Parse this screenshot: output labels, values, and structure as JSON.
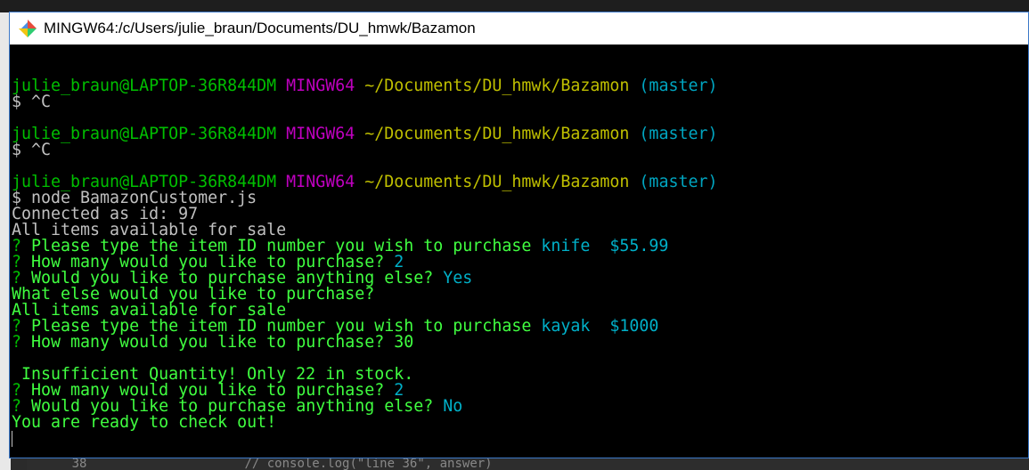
{
  "window": {
    "title": "MINGW64:/c/Users/julie_braun/Documents/DU_hmwk/Bazamon"
  },
  "background_editor": {
    "bottom_line_number": "38",
    "bottom_code": "// console.log(\"line 36\", answer)"
  },
  "colors": {
    "prompt_user": "#00bf00",
    "prompt_mingw": "#bf00bf",
    "prompt_path": "#bfbf00",
    "prompt_branch": "#00a5c0",
    "plain": "#c0c0c0",
    "question_mark": "#00c000",
    "question_text": "#40ff40",
    "answer": "#00b0c8"
  },
  "terminal": {
    "lines": [
      [],
      [
        {
          "t": "julie_braun@LAPTOP-36R844DM",
          "c": "prompt_user"
        },
        {
          "t": " MINGW64",
          "c": "prompt_mingw"
        },
        {
          "t": " ~/Documents/DU_hmwk/Bazamon",
          "c": "prompt_path"
        },
        {
          "t": " (master)",
          "c": "prompt_branch"
        }
      ],
      [
        {
          "t": "$ ^C",
          "c": "plain"
        }
      ],
      [],
      [
        {
          "t": "julie_braun@LAPTOP-36R844DM",
          "c": "prompt_user"
        },
        {
          "t": " MINGW64",
          "c": "prompt_mingw"
        },
        {
          "t": " ~/Documents/DU_hmwk/Bazamon",
          "c": "prompt_path"
        },
        {
          "t": " (master)",
          "c": "prompt_branch"
        }
      ],
      [
        {
          "t": "$ ^C",
          "c": "plain"
        }
      ],
      [],
      [
        {
          "t": "julie_braun@LAPTOP-36R844DM",
          "c": "prompt_user"
        },
        {
          "t": " MINGW64",
          "c": "prompt_mingw"
        },
        {
          "t": " ~/Documents/DU_hmwk/Bazamon",
          "c": "prompt_path"
        },
        {
          "t": " (master)",
          "c": "prompt_branch"
        }
      ],
      [
        {
          "t": "$ node BamazonCustomer.js",
          "c": "plain"
        }
      ],
      [
        {
          "t": "Connected as id: 97",
          "c": "plain"
        }
      ],
      [
        {
          "t": "All items available for sale",
          "c": "plain"
        }
      ],
      [
        {
          "t": "?",
          "c": "question_mark"
        },
        {
          "t": " Please type the item ID number you wish to purchase ",
          "c": "question_text"
        },
        {
          "t": "knife  $55.99",
          "c": "answer"
        }
      ],
      [
        {
          "t": "?",
          "c": "question_mark"
        },
        {
          "t": " How many would you like to purchase? ",
          "c": "question_text"
        },
        {
          "t": "2",
          "c": "answer"
        }
      ],
      [
        {
          "t": "?",
          "c": "question_mark"
        },
        {
          "t": " Would you like to purchase anything else? ",
          "c": "question_text"
        },
        {
          "t": "Yes",
          "c": "answer"
        }
      ],
      [
        {
          "t": "What else would you like to purchase?",
          "c": "question_text"
        }
      ],
      [
        {
          "t": "All items available for sale",
          "c": "question_text"
        }
      ],
      [
        {
          "t": "?",
          "c": "question_mark"
        },
        {
          "t": " Please type the item ID number you wish to purchase ",
          "c": "question_text"
        },
        {
          "t": "kayak  $1000",
          "c": "answer"
        }
      ],
      [
        {
          "t": "?",
          "c": "question_mark"
        },
        {
          "t": " How many would you like to purchase? 30",
          "c": "question_text"
        }
      ],
      [],
      [
        {
          "t": " Insufficient Quantity! Only 22 in stock.",
          "c": "question_text"
        }
      ],
      [
        {
          "t": "?",
          "c": "question_mark"
        },
        {
          "t": " How many would you like to purchase? ",
          "c": "question_text"
        },
        {
          "t": "2",
          "c": "answer"
        }
      ],
      [
        {
          "t": "?",
          "c": "question_mark"
        },
        {
          "t": " Would you like to purchase anything else? ",
          "c": "question_text"
        },
        {
          "t": "No",
          "c": "answer"
        }
      ],
      [
        {
          "t": "You are ready to check out!",
          "c": "question_text"
        }
      ]
    ]
  }
}
